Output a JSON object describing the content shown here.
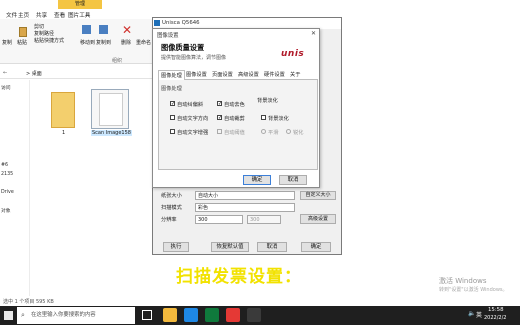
{
  "explorer": {
    "manage_tab": "管理",
    "tabs": [
      "文件",
      "主页",
      "共享",
      "查看",
      "图片工具"
    ],
    "ribbon_buttons": [
      "复制",
      "粘贴",
      "剪切",
      "复制路径",
      "粘贴快捷方式",
      "移动到",
      "复制到",
      "删除",
      "重命名"
    ],
    "ribbon_group": "组织",
    "address_path": "> 桌面",
    "tree_items": [
      "访问",
      "",
      "",
      "",
      "",
      "",
      "",
      "",
      "",
      "#6",
      "2135",
      "",
      "Drive",
      "",
      "对象",
      "",
      "",
      "",
      "",
      "",
      "",
      "",
      "",
      ""
    ],
    "file_folder_name": "1",
    "file_image_name": "Scan Image158",
    "status_text": "选中 1 个项目  595 KB"
  },
  "scanner": {
    "title": "Unisca Q5646",
    "paper_size_label": "纸张大小",
    "paper_size_value": "自动大小",
    "custom_size_button": "自定义大小",
    "scan_mode_label": "扫描模式",
    "scan_mode_value": "彩色",
    "resolution_label": "分辨率",
    "resolution_value": "300",
    "resolution_secondary": "300",
    "advanced_button": "高级设置",
    "buttons": {
      "execute": "执行",
      "save_default": "恢复默认值",
      "cancel": "取消",
      "ok": "确定"
    }
  },
  "dialog": {
    "window_title": "图像设置",
    "heading": "图像质量设置",
    "subtitle": "提供智能图像算法，调节图像",
    "logo_text": "unis",
    "tabs": [
      "图像处理",
      "图像设置",
      "页面设置",
      "高级设置",
      "硬件设置",
      "关于"
    ],
    "active_tab_index": 0,
    "group_label": "图像处理",
    "background_group_label": "背景淡化",
    "checkboxes": [
      {
        "label": "自动纠偏斜",
        "checked": true
      },
      {
        "label": "自动去白页",
        "checked": false
      },
      {
        "label": "自动文字方向",
        "checked": false
      },
      {
        "label": "自动裁剪",
        "checked": true
      },
      {
        "label": "自动文字增强",
        "checked": false
      },
      {
        "label": "自动阈值",
        "checked": false,
        "disabled": true
      },
      {
        "label": "自动去色",
        "checked": true
      },
      {
        "label": "背景淡化",
        "checked": false
      }
    ],
    "radios": [
      "平滑",
      "锐化"
    ],
    "ok_button": "确定",
    "cancel_button": "取消"
  },
  "caption": "扫描发票设置：",
  "activation": {
    "line1": "激活 Windows",
    "line2": "转到\"设置\"以激活 Windows。"
  },
  "taskbar": {
    "search_placeholder": "在这里输入你要搜索的内容",
    "time": "15:58",
    "date": "2022/2/2",
    "icon_colors": [
      "#f3b93d",
      "#1e88e5",
      "#0f7a3c",
      "#e53935",
      "#ffffff",
      "#4a90d9",
      "#6a6a6a"
    ]
  }
}
